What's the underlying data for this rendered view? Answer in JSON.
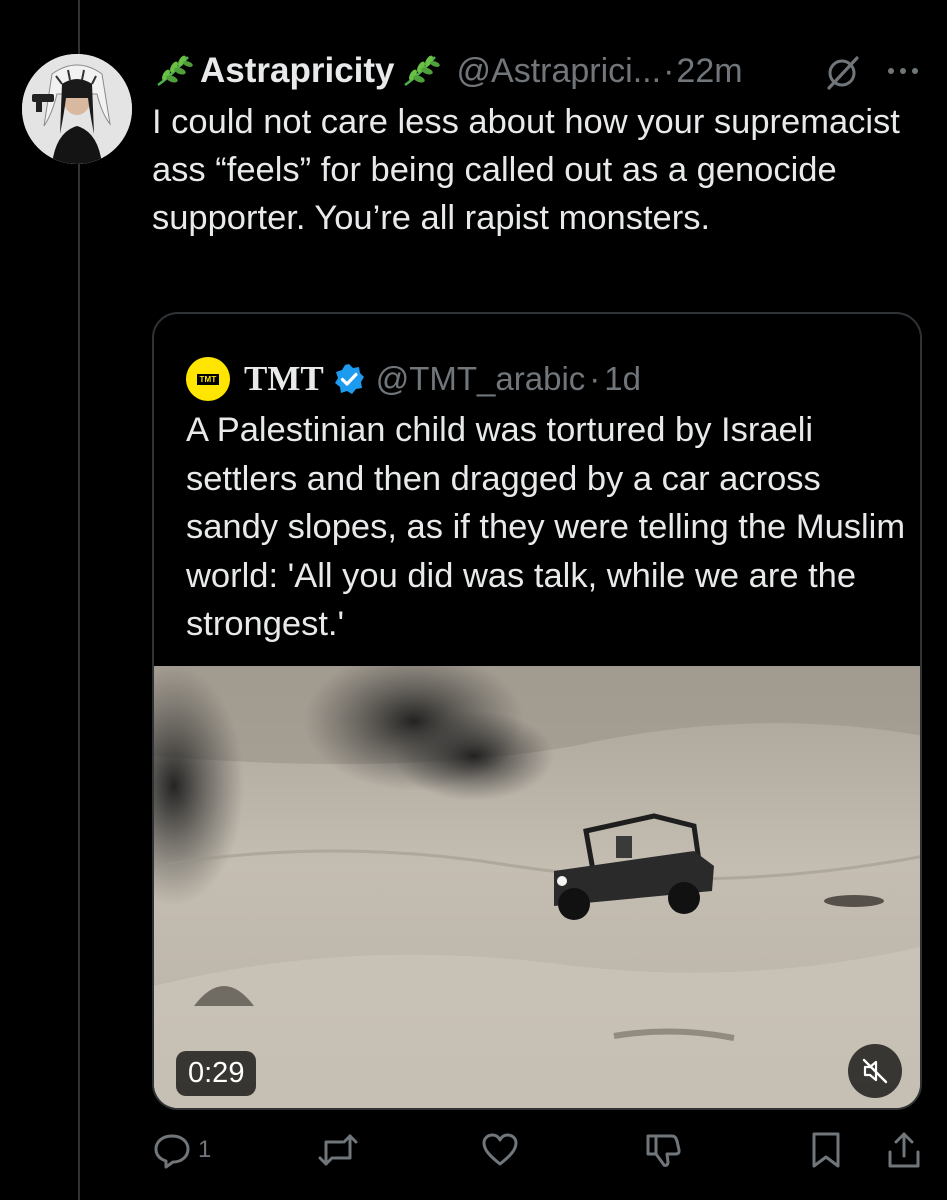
{
  "colors": {
    "background": "#000000",
    "text_primary": "#e7e9ea",
    "text_secondary": "#71767b",
    "border": "#2f3336",
    "verified_blue": "#1d9bf0",
    "tmt_yellow": "#ffe500"
  },
  "post": {
    "display_name": "Astrapricity",
    "name_decoration_icon": "herb-icon",
    "handle": "@Astraprici...",
    "time": "22m",
    "separator": "·",
    "text": "I could not care less about how your supremacist ass “feels” for being called out as a genocide supporter. You’re all rapist monsters."
  },
  "quote": {
    "avatar_text": "TMT",
    "display_name": "TMT",
    "handle": "@TMT_arabic",
    "separator": "·",
    "time": "1d",
    "verified": true,
    "text": "A Palestinian child was tortured by Israeli settlers and then dragged by a car across sandy slopes, as if they were telling the Muslim world: 'All you did was talk, while we are the strongest.'",
    "video": {
      "duration": "0:29",
      "muted": true
    }
  },
  "actions": {
    "reply_count": "1",
    "icons": [
      "reply-icon",
      "repost-icon",
      "like-icon",
      "downvote-icon",
      "bookmark-icon",
      "share-icon"
    ]
  }
}
